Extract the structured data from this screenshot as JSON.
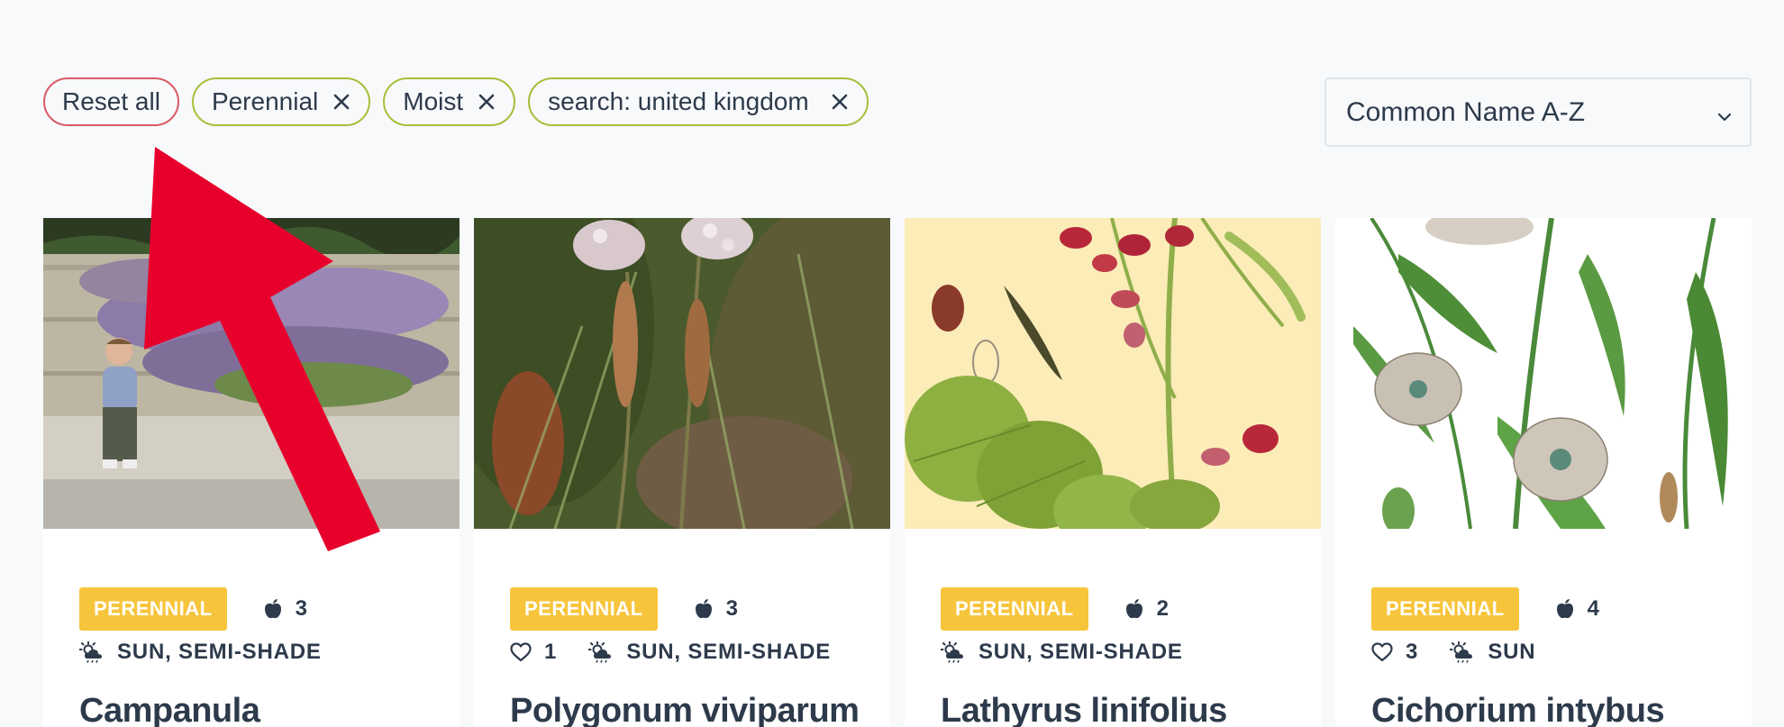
{
  "filters": {
    "reset_label": "Reset all",
    "chips": [
      {
        "label": "Perennial"
      },
      {
        "label": "Moist"
      },
      {
        "label": "search: united kingdom"
      }
    ]
  },
  "sort": {
    "selected": "Common Name A-Z"
  },
  "cards": [
    {
      "badge": "PERENNIAL",
      "edible_count": "3",
      "likes": "",
      "light": "SUN, SEMI-SHADE",
      "title": "Campanula"
    },
    {
      "badge": "PERENNIAL",
      "edible_count": "3",
      "likes": "1",
      "light": "SUN, SEMI-SHADE",
      "title": "Polygonum viviparum"
    },
    {
      "badge": "PERENNIAL",
      "edible_count": "2",
      "likes": "",
      "light": "SUN, SEMI-SHADE",
      "title": "Lathyrus linifolius"
    },
    {
      "badge": "PERENNIAL",
      "edible_count": "4",
      "likes": "3",
      "light": "SUN",
      "title": "Cichorium intybus"
    }
  ],
  "icons": {
    "remove": "close-icon",
    "dropdown": "chevron-down-icon",
    "edible": "apple-icon",
    "likes": "heart-icon",
    "light": "sun-cloud-icon"
  },
  "colors": {
    "chip_border": "#a6bf3a",
    "reset_border": "#d95a66",
    "badge": "#f7c53c",
    "arrow": "#e8002d",
    "text": "#2d3a4b"
  }
}
